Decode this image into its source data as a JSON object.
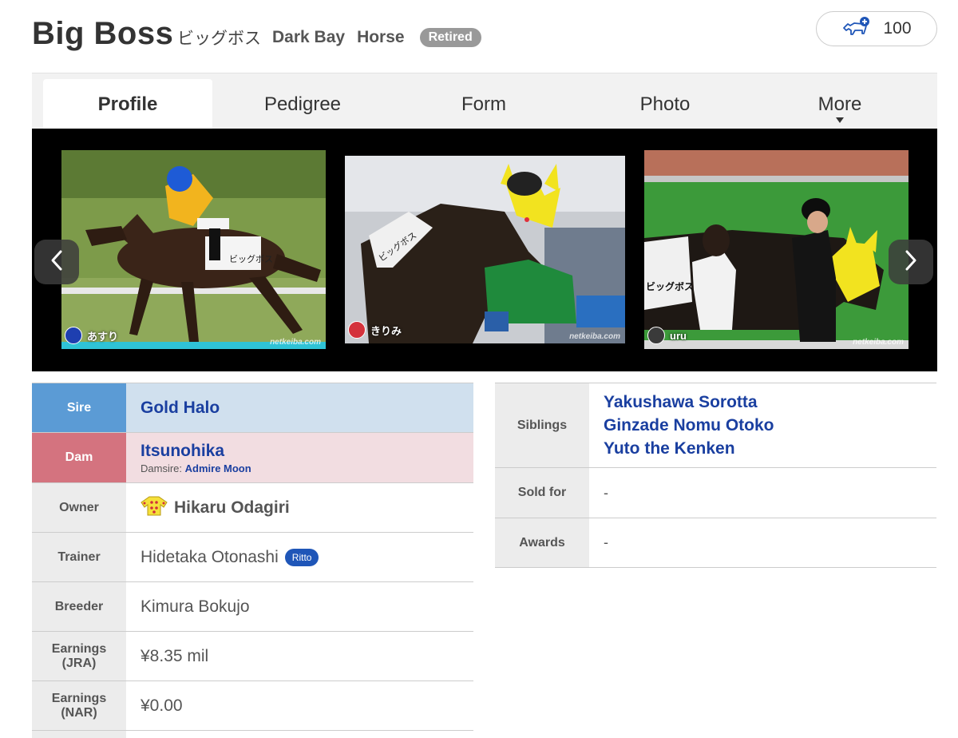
{
  "header": {
    "horse_name": "Big Boss",
    "name_kana": "ビッグボス",
    "coat": "Dark Bay",
    "sex": "Horse",
    "status_badge": "Retired",
    "favorite_count": "100"
  },
  "tabs": [
    {
      "label": "Profile",
      "active": true
    },
    {
      "label": "Pedigree",
      "active": false
    },
    {
      "label": "Form",
      "active": false
    },
    {
      "label": "Photo",
      "active": false
    },
    {
      "label": "More",
      "active": false
    }
  ],
  "carousel": {
    "photos": [
      {
        "user": "あすり",
        "watermark": "netkeiba.com"
      },
      {
        "user": "きりみ",
        "watermark": "netkeiba.com"
      },
      {
        "user": "uru",
        "watermark": "netkeiba.com"
      }
    ],
    "prev_icon": "chevron-left-icon",
    "next_icon": "chevron-right-icon"
  },
  "profile": {
    "sire": {
      "label": "Sire",
      "value": "Gold Halo"
    },
    "dam": {
      "label": "Dam",
      "value": "Itsunohika",
      "damsire_label": "Damsire:",
      "damsire": "Admire Moon"
    },
    "owner": {
      "label": "Owner",
      "value": "Hikaru Odagiri",
      "icon": "silks-icon"
    },
    "trainer": {
      "label": "Trainer",
      "value": "Hidetaka Otonashi",
      "badge": "Ritto"
    },
    "breeder": {
      "label": "Breeder",
      "value": "Kimura Bokujo"
    },
    "earnings_jra": {
      "label_line1": "Earnings",
      "label_line2": "(JRA)",
      "value": "¥8.35 mil"
    },
    "earnings_nar": {
      "label_line1": "Earnings",
      "label_line2": "(NAR)",
      "value": "¥0.00"
    }
  },
  "side": {
    "siblings": {
      "label": "Siblings",
      "items": [
        "Yakushawa Sorotta",
        "Ginzade Nomu Otoko",
        "Yuto the Kenken"
      ]
    },
    "sold_for": {
      "label": "Sold for",
      "value": "-"
    },
    "awards": {
      "label": "Awards",
      "value": "-"
    }
  },
  "colors": {
    "link": "#1a3fa0",
    "sire_header": "#5b9bd5",
    "sire_cell": "#d0e0ee",
    "dam_header": "#d4737f",
    "dam_cell": "#f2dde1",
    "ritto_badge": "#1f56b8"
  }
}
